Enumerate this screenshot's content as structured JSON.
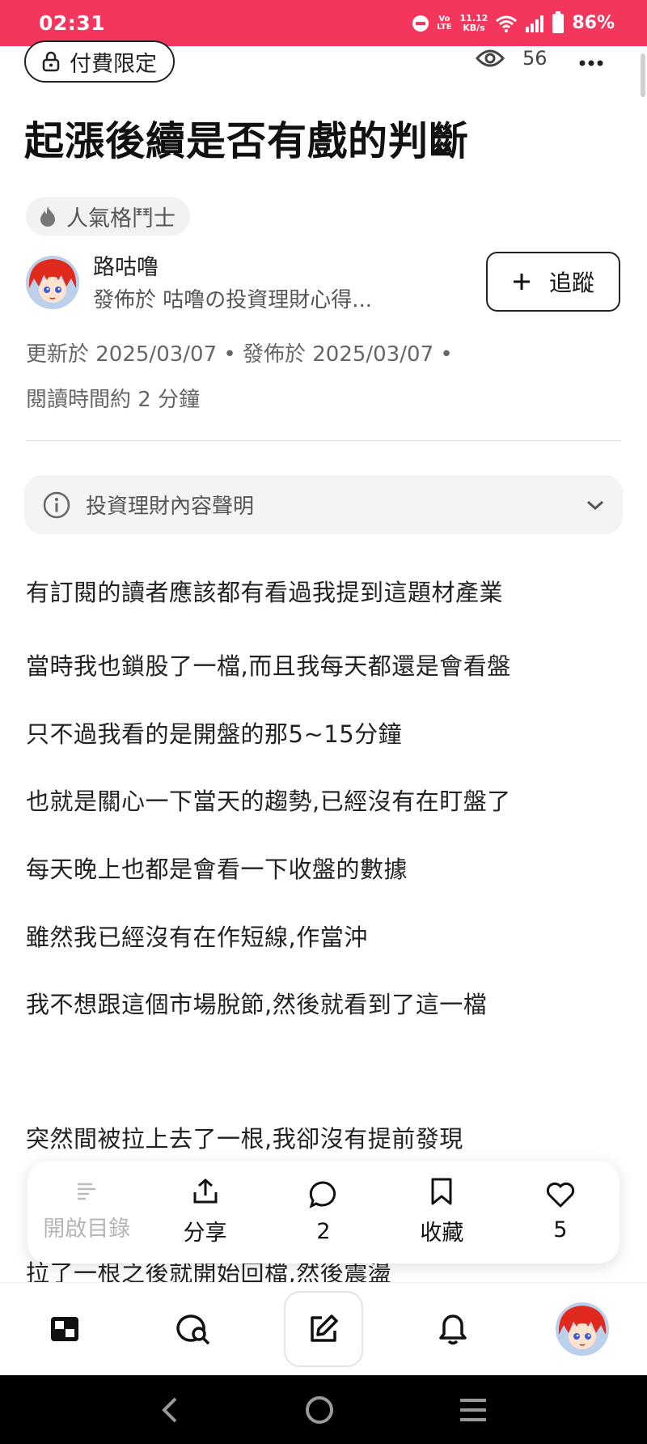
{
  "status_bar": {
    "time": "02:31",
    "volte": [
      "Vo",
      "LTE"
    ],
    "net_speed": [
      "11.12",
      "KB/s"
    ],
    "battery": "86%",
    "color": "#f5365c"
  },
  "header": {
    "paid_badge": "付費限定",
    "views": "56"
  },
  "article": {
    "title": "起漲後續是否有戲的判斷",
    "tag": "人氣格鬥士",
    "author": {
      "name": "路咕噜",
      "published_in_prefix": "發佈於",
      "publication": "咕噜の投資理財心得..."
    },
    "follow_label": "追蹤",
    "meta_line1": "更新於 2025/03/07 • 發佈於 2025/03/07 •",
    "meta_line2": "閱讀時間約 2 分鐘",
    "disclaimer": "投資理財內容聲明",
    "paragraphs": [
      "有訂閱的讀者應該都有看過我提到這題材產業",
      "當時我也鎖股了一檔,而且我每天都還是會看盤",
      "只不過我看的是開盤的那5~15分鐘",
      "也就是關心一下當天的趨勢,已經沒有在盯盤了",
      "每天晚上也都是會看一下收盤的數據",
      "雖然我已經沒有在作短線,作當沖",
      "我不想跟這個市場脫節,然後就看到了這一檔",
      "突然間被拉上去了一根,我卻沒有提前發現",
      "拉了一根之後就開始回檔,然後震盪"
    ]
  },
  "action_bar": {
    "toc": "開啟目錄",
    "share": "分享",
    "comments": "2",
    "bookmark": "收藏",
    "likes": "5"
  }
}
